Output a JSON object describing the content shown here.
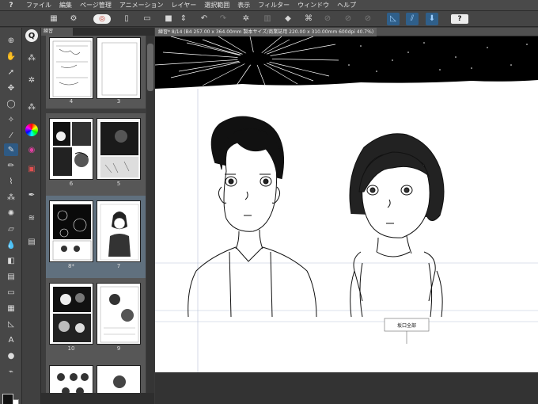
{
  "menubar": {
    "logo": "?",
    "items": [
      "ファイル",
      "編集",
      "ページ管理",
      "アニメーション",
      "レイヤー",
      "選択範囲",
      "表示",
      "フィルター",
      "ウィンドウ",
      "ヘルプ"
    ]
  },
  "toolbar": {
    "help_label": "?"
  },
  "panel": {
    "tab_label": "練習",
    "pages": [
      {
        "left": "4",
        "right": "3"
      },
      {
        "left": "6",
        "right": "5"
      },
      {
        "left": "8*",
        "right": "7"
      },
      {
        "left": "10",
        "right": "9"
      }
    ]
  },
  "document": {
    "tab_label": "練習* 8/14 (B4 257.00 x 364.00mm 製本サイズ/商業誌用 220.00 x 310.00mm 600dpi 40.7%)",
    "annotation": "坂口全部"
  },
  "colors": {
    "accent": "#2e5a84",
    "panel_bg": "#3d3d3d",
    "paper": "#ffffff"
  }
}
